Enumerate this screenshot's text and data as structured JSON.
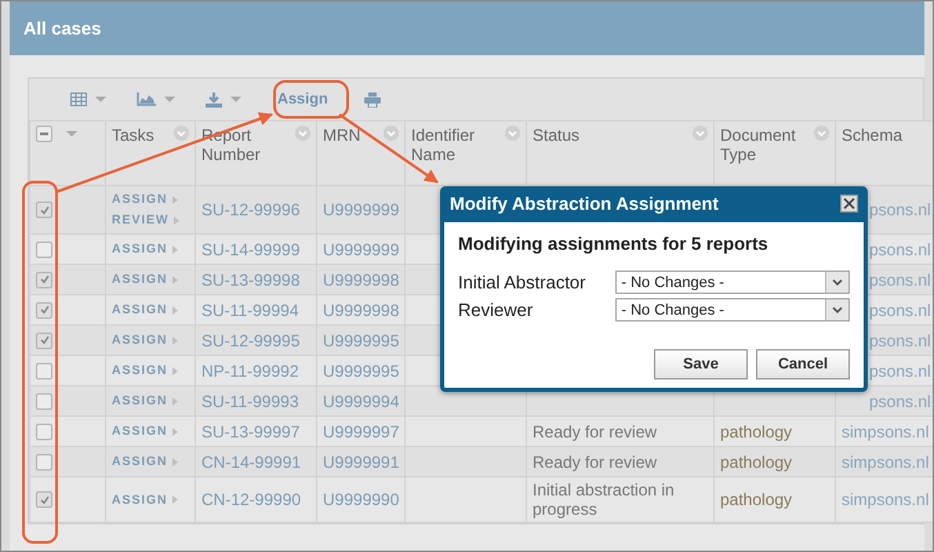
{
  "header": {
    "title": "All cases"
  },
  "toolbar": {
    "assign_label": "Assign"
  },
  "table": {
    "select_all": {
      "partial": true
    },
    "columns": [
      {
        "label": "Tasks",
        "menu": true
      },
      {
        "label": "Report Number",
        "menu": true
      },
      {
        "label": "MRN",
        "menu": true
      },
      {
        "label": "Identifier Name",
        "menu": true
      },
      {
        "label": "Status",
        "menu": true
      },
      {
        "label": "Document Type",
        "menu": true
      },
      {
        "label": "Schema",
        "menu": false
      }
    ],
    "rows": [
      {
        "checked": true,
        "tasks": [
          "ASSIGN",
          "REVIEW"
        ],
        "report": "SU-12-99996",
        "mrn": "U9999999",
        "schema": "psons.nl"
      },
      {
        "checked": false,
        "tasks": [
          "ASSIGN"
        ],
        "report": "SU-14-99999",
        "mrn": "U9999999",
        "schema": "psons.nl"
      },
      {
        "checked": true,
        "tasks": [
          "ASSIGN"
        ],
        "report": "SU-13-99998",
        "mrn": "U9999998",
        "schema": "psons.nl"
      },
      {
        "checked": true,
        "tasks": [
          "ASSIGN"
        ],
        "report": "SU-11-99994",
        "mrn": "U9999998",
        "schema": "psons.nl"
      },
      {
        "checked": true,
        "tasks": [
          "ASSIGN"
        ],
        "report": "SU-12-99995",
        "mrn": "U9999995",
        "schema": "psons.nl"
      },
      {
        "checked": false,
        "tasks": [
          "ASSIGN"
        ],
        "report": "NP-11-99992",
        "mrn": "U9999995",
        "schema": "psons.nl"
      },
      {
        "checked": false,
        "tasks": [
          "ASSIGN"
        ],
        "report": "SU-11-99993",
        "mrn": "U9999994",
        "schema": "psons.nl"
      },
      {
        "checked": false,
        "tasks": [
          "ASSIGN"
        ],
        "report": "SU-13-99997",
        "mrn": "U9999997",
        "status": "Ready for review",
        "doc_type": "pathology",
        "schema": "simpsons.nl"
      },
      {
        "checked": false,
        "tasks": [
          "ASSIGN"
        ],
        "report": "CN-14-99991",
        "mrn": "U9999991",
        "status": "Ready for review",
        "doc_type": "pathology",
        "schema": "simpsons.nl"
      },
      {
        "checked": true,
        "tasks": [
          "ASSIGN"
        ],
        "report": "CN-12-99990",
        "mrn": "U9999990",
        "status": "Initial abstraction in progress",
        "doc_type": "pathology",
        "schema": "simpsons.nl"
      }
    ]
  },
  "dialog": {
    "title": "Modify Abstraction Assignment",
    "heading": "Modifying assignments for 5 reports",
    "fields": [
      {
        "label": "Initial Abstractor",
        "value": "- No Changes -"
      },
      {
        "label": "Reviewer",
        "value": "- No Changes -"
      }
    ],
    "buttons": [
      "Save",
      "Cancel"
    ]
  }
}
